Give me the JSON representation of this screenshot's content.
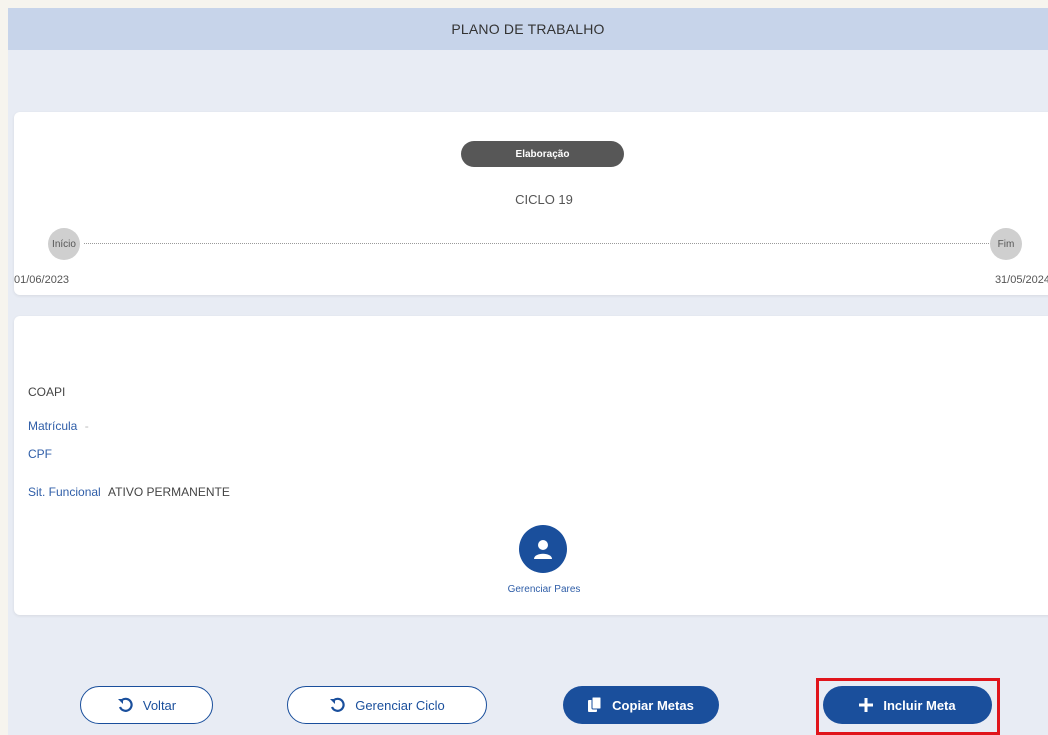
{
  "header": {
    "title": "PLANO DE TRABALHO"
  },
  "cycle": {
    "status": "Elaboração",
    "title": "CICLO 19",
    "start_node": "Início",
    "end_node": "Fim",
    "start_date": "01/06/2023",
    "end_date": "31/05/2024"
  },
  "profile": {
    "unit": "COAPI",
    "matricula_label": "Matrícula",
    "matricula_value": "-",
    "cpf_label": "CPF",
    "sit_label": "Sit. Funcional",
    "sit_value": "ATIVO PERMANENTE",
    "pares_label": "Gerenciar Pares"
  },
  "actions": {
    "voltar": "Voltar",
    "gerenciar_ciclo": "Gerenciar Ciclo",
    "copiar_metas": "Copiar Metas",
    "incluir_meta": "Incluir Meta"
  },
  "colors": {
    "header": "#c7d4ea",
    "primary": "#1a4f9c",
    "status_pill": "#575757",
    "highlight": "#e0141b"
  }
}
